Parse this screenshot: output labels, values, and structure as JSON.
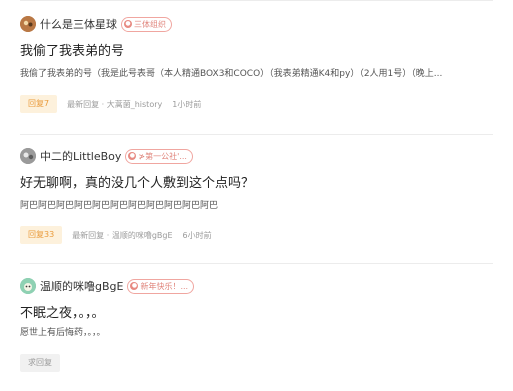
{
  "colors": {
    "accent": "#e99a3a",
    "badge_bg": "#fdf1dc",
    "tag_border": "#f0a6a0",
    "divider": "#ececec"
  },
  "posts": [
    {
      "author": "什么是三体星球",
      "avatar_icon": "user-avatar-icon",
      "tag": "三体组织",
      "title": "我偷了我表弟的号",
      "summary": "我偷了我表弟的号（我是此号表哥（本人精通BOX3和COCO）（我表弟精通K4和py）（2人用1号）（晚上...",
      "reply_label": "回复7",
      "last_reply": "最新回复 · 大蒿菌_history",
      "time": "1小时前"
    },
    {
      "author": "中二的LittleBoy",
      "avatar_icon": "user-avatar-icon",
      "tag": "≯第一公社'...",
      "title": "好无聊啊，真的没几个人敷到这个点吗？",
      "summary": "阿巴阿巴阿巴阿巴阿巴阿巴阿巴阿巴阿巴阿巴阿巴",
      "reply_label": "回复33",
      "last_reply": "最新回复 · 温顺的咪噜gBgE",
      "time": "6小时前"
    },
    {
      "author": "温顺的咪噜gBgE",
      "avatar_icon": "user-avatar-icon",
      "tag": "新年快乐！...",
      "title": "不眠之夜，。，。",
      "summary": "愿世上有后悔药，。，。",
      "reply_label": "求回复",
      "last_reply": "",
      "time": ""
    }
  ]
}
